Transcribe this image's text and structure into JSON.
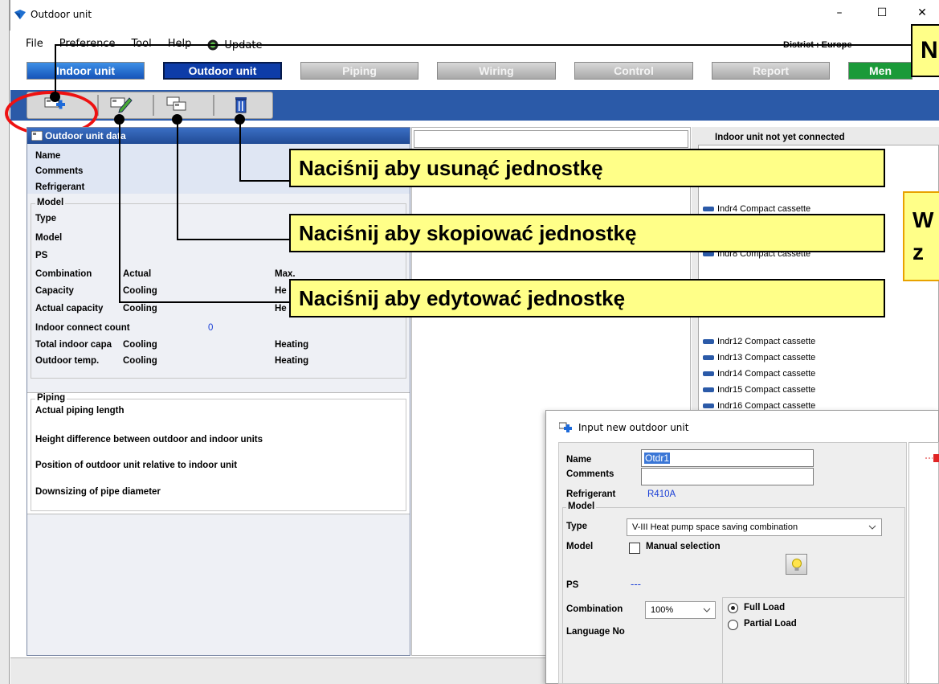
{
  "window": {
    "title": "Outdoor unit",
    "min_glyph": "–",
    "max_glyph": "☐",
    "close_glyph": "✕"
  },
  "menu": {
    "items": [
      "File",
      "Preference",
      "Tool",
      "Help",
      "Update"
    ],
    "district": "District : Europe"
  },
  "tabs": [
    {
      "label": "Indoor unit",
      "state": "active"
    },
    {
      "label": "Outdoor unit",
      "state": "selected"
    },
    {
      "label": "Piping",
      "state": "inactive"
    },
    {
      "label": "Wiring",
      "state": "inactive"
    },
    {
      "label": "Control",
      "state": "inactive"
    },
    {
      "label": "Report",
      "state": "inactive"
    },
    {
      "label": "Men",
      "state": "green"
    }
  ],
  "toolbar": {
    "icons": [
      "add-unit-icon",
      "edit-unit-icon",
      "copy-unit-icon",
      "delete-unit-icon"
    ]
  },
  "left_panel": {
    "title": "Outdoor unit data",
    "name": "Name",
    "comments": "Comments",
    "refrigerant": "Refrigerant",
    "model_group": "Model",
    "type": "Type",
    "model": "Model",
    "ps": "PS",
    "combination": "Combination",
    "combination_actual": "Actual",
    "combination_max": "Max.",
    "capacity": "Capacity",
    "capacity_cooling": "Cooling",
    "capacity_heating": "He",
    "actual_capacity": "Actual capacity",
    "actual_capacity_cooling": "Cooling",
    "actual_capacity_heating": "He",
    "indoor_connect_count": "Indoor connect count",
    "indoor_connect_value": "0",
    "total_indoor_capa": "Total indoor capa",
    "total_indoor_cooling": "Cooling",
    "total_indoor_heating": "Heating",
    "outdoor_temp": "Outdoor temp.",
    "outdoor_temp_cooling": "Cooling",
    "outdoor_temp_heating": "Heating",
    "piping_group": "Piping",
    "actual_piping_length": "Actual piping length",
    "height_difference": "Height difference between outdoor and indoor units",
    "position_outdoor": "Position of outdoor unit relative to indoor unit",
    "downsizing": "Downsizing of pipe diameter"
  },
  "right_panel": {
    "title": "Indoor unit not yet connected",
    "items": [
      "Indr4  Compact cassette",
      "Indr8  Compact cassette",
      "Indr12  Compact cassette",
      "Indr13  Compact cassette",
      "Indr14  Compact cassette",
      "Indr15  Compact cassette",
      "Indr16  Compact cassette"
    ]
  },
  "callouts": {
    "delete": "Naciśnij aby usunąć jednostkę",
    "copy": "Naciśnij aby skopiować jednostkę",
    "edit": "Naciśnij aby edytować jednostkę",
    "new_partial": "N",
    "right_partial_line1": "W",
    "right_partial_line2": "z"
  },
  "dialog": {
    "title": "Input new outdoor unit",
    "name_label": "Name",
    "name_value": "Otdr1",
    "comments_label": "Comments",
    "comments_value": "",
    "refrigerant_label": "Refrigerant",
    "refrigerant_value": "R410A",
    "model_group": "Model",
    "type_label": "Type",
    "type_value": "V-III Heat pump space saving combination",
    "model_label": "Model",
    "manual_selection": "Manual selection",
    "ps_label": "PS",
    "ps_value": "---",
    "combination_label": "Combination",
    "combination_value": "100%",
    "full_load": "Full Load",
    "partial_load": "Partial Load",
    "language_no": "Language No"
  },
  "colors": {
    "accent_blue": "#2b5aa8",
    "callout_yellow": "#ffff88",
    "highlight_red": "#ee1111",
    "value_blue": "#1a3fd6"
  }
}
